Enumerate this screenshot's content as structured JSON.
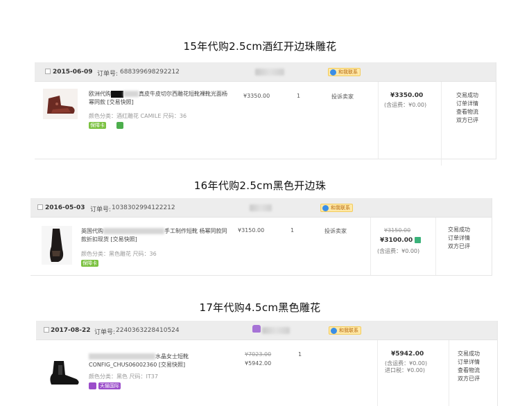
{
  "captions": [
    "15年代购2.5cm酒红开边珠雕花",
    "16年代购2.5cm黑色开边珠",
    "17年代购4.5cm黑色雕花"
  ],
  "order_label": "订单号:",
  "contact_label": "和我联系",
  "orders": [
    {
      "date": "2015-06-09",
      "order_no": "688399698292212",
      "title_prefix": "欧洲代购",
      "title_rest": "真皮牛皮切尔西雕花短靴裸靴光面杨幂同款 [交易快照]",
      "sku": "颜色分类：酒红雕花 CAMILE  尺码：36",
      "badges": [
        "保障卡"
      ],
      "unit_price_original": "",
      "unit_price": "¥3350.00",
      "quantity": "1",
      "service": "投诉卖家",
      "total": "¥3350.00",
      "shipping": [
        "(含运费：¥0.00)"
      ],
      "status_lines": [
        "交易成功",
        "订单详情",
        "查看物流",
        "双方已评"
      ]
    },
    {
      "date": "2016-05-03",
      "order_no": "1038302994122212",
      "title_prefix": "英国代购",
      "title_rest": "手工制作短靴 杨幂同款同款折扣现货 [交易快照]",
      "sku": "颜色分类：黑色雕花  尺码：36",
      "badges": [
        "保障卡"
      ],
      "unit_price_original": "",
      "unit_price": "¥3150.00",
      "quantity": "1",
      "service": "投诉卖家",
      "total_original": "¥3150.00",
      "total": "¥3100.00",
      "shipping": [
        "(含运费：¥0.00)"
      ],
      "status_lines": [
        "交易成功",
        "订单详情",
        "双方已评"
      ]
    },
    {
      "date": "2017-08-22",
      "order_no": "2240363228410524",
      "title_prefix": "",
      "title_rest": "水晶女士短靴 CONFIG_CHUS06002360 [交易快照]",
      "sku": "颜色分类：黑色  尺码：IT37",
      "badges": [
        "天猫国际"
      ],
      "unit_price_original": "¥7023.00",
      "unit_price": "¥5942.00",
      "quantity": "1",
      "service": "",
      "total": "¥5942.00",
      "shipping": [
        "(含运费：¥0.00)",
        "进口税：¥0.00)"
      ],
      "status_lines": [
        "交易成功",
        "订单详情",
        "查看物流",
        "双方已评"
      ]
    }
  ],
  "colors": {
    "header_bg": "#ededed",
    "badge_green": "#7cc242",
    "badge_purple": "#9b4dca",
    "badge_red": "#d9251d",
    "contact_bg": "#ffe9a8"
  }
}
